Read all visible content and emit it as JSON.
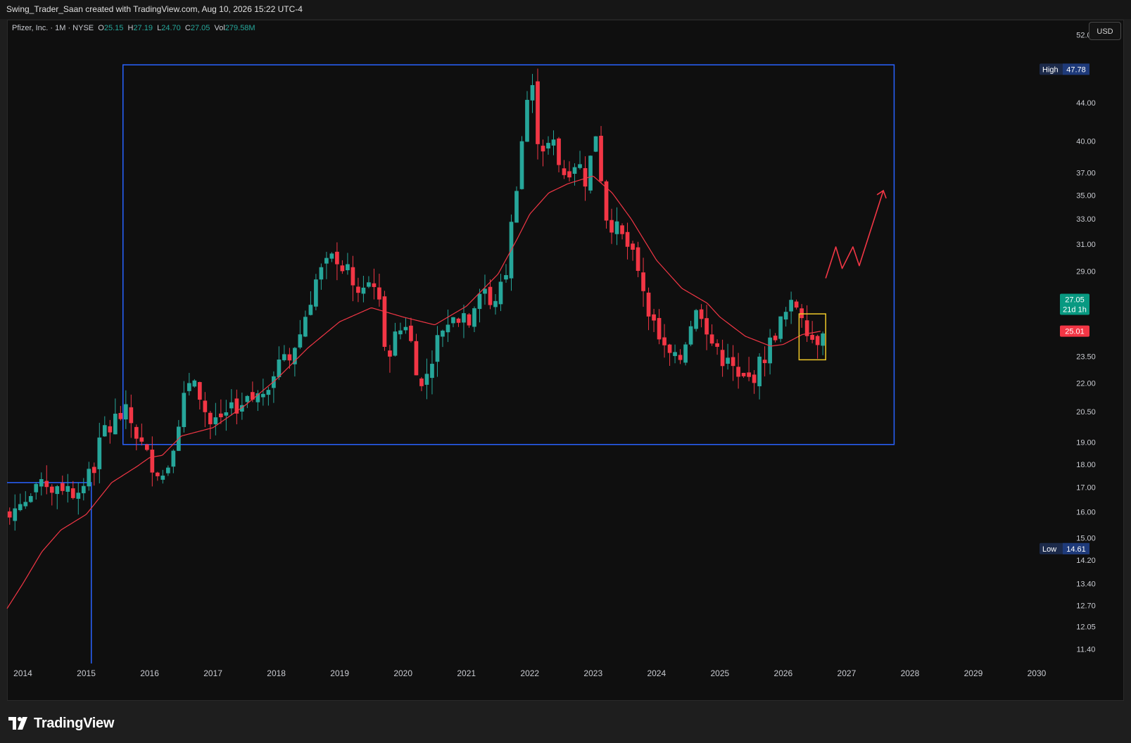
{
  "header": {
    "attribution": "Swing_Trader_Saan created with TradingView.com, Aug 10, 2026 15:22 UTC-4"
  },
  "legend": {
    "symbol": "Pfizer, Inc. · 1M · NYSE",
    "o_label": "O",
    "o_value": "25.15",
    "h_label": "H",
    "h_value": "27.19",
    "l_label": "L",
    "l_value": "24.70",
    "c_label": "C",
    "c_value": "27.05",
    "vol_label": "Vol",
    "vol_value": "279.58M"
  },
  "currency_button": "USD",
  "brand": {
    "name": "TradingView"
  },
  "colors": {
    "background": "#0f0f0f",
    "up": "#26a69a",
    "down": "#f23645",
    "moving_average": "#f23645",
    "range_box": "#2962ff",
    "highlight_box": "#f0c929",
    "projection_arrow": "#f23645"
  },
  "chart_data": {
    "type": "candlestick",
    "symbol": "PFE",
    "interval": "1M",
    "scale": "log",
    "ylim": [
      11.0,
      54.0
    ],
    "xlim": [
      2013.75,
      2030.3
    ],
    "x_ticks": [
      "2014",
      "2015",
      "2016",
      "2017",
      "2018",
      "2019",
      "2020",
      "2021",
      "2022",
      "2023",
      "2024",
      "2025",
      "2026",
      "2027",
      "2028",
      "2029",
      "2030"
    ],
    "y_ticks": [
      "52.00",
      "44.00",
      "40.00",
      "37.00",
      "35.00",
      "33.00",
      "31.00",
      "29.00",
      "23.50",
      "22.00",
      "20.50",
      "19.00",
      "18.00",
      "17.00",
      "16.00",
      "15.00",
      "14.20",
      "13.40",
      "12.70",
      "12.05",
      "11.40"
    ],
    "price_labels": [
      {
        "tag": "High",
        "value": "47.78",
        "price": 47.78,
        "kind": "high"
      },
      {
        "tag": "Low",
        "value": "14.61",
        "price": 14.61,
        "kind": "low"
      },
      {
        "tag": "",
        "value": "27.05",
        "sub": "21d 1h",
        "price": 27.05,
        "kind": "last"
      },
      {
        "tag": "",
        "value": "25.01",
        "price": 25.01,
        "kind": "ma"
      }
    ],
    "ma_anchors": [
      {
        "x": 2013.75,
        "y": 12.6
      },
      {
        "x": 2014.0,
        "y": 13.4
      },
      {
        "x": 2014.3,
        "y": 14.5
      },
      {
        "x": 2014.6,
        "y": 15.3
      },
      {
        "x": 2015.0,
        "y": 15.9
      },
      {
        "x": 2015.4,
        "y": 17.2
      },
      {
        "x": 2015.8,
        "y": 17.9
      },
      {
        "x": 2016.0,
        "y": 18.3
      },
      {
        "x": 2016.2,
        "y": 18.4
      },
      {
        "x": 2016.5,
        "y": 19.3
      },
      {
        "x": 2017.0,
        "y": 19.7
      },
      {
        "x": 2017.5,
        "y": 20.8
      },
      {
        "x": 2018.0,
        "y": 22.2
      },
      {
        "x": 2018.5,
        "y": 24.0
      },
      {
        "x": 2019.0,
        "y": 25.6
      },
      {
        "x": 2019.5,
        "y": 26.5
      },
      {
        "x": 2020.0,
        "y": 25.9
      },
      {
        "x": 2020.5,
        "y": 25.4
      },
      {
        "x": 2021.0,
        "y": 26.6
      },
      {
        "x": 2021.5,
        "y": 28.8
      },
      {
        "x": 2021.8,
        "y": 31.4
      },
      {
        "x": 2022.0,
        "y": 33.4
      },
      {
        "x": 2022.3,
        "y": 35.2
      },
      {
        "x": 2022.6,
        "y": 36.0
      },
      {
        "x": 2023.0,
        "y": 36.7
      },
      {
        "x": 2023.3,
        "y": 35.2
      },
      {
        "x": 2023.6,
        "y": 33.0
      },
      {
        "x": 2024.0,
        "y": 29.8
      },
      {
        "x": 2024.4,
        "y": 27.8
      },
      {
        "x": 2024.8,
        "y": 26.8
      },
      {
        "x": 2025.0,
        "y": 25.9
      },
      {
        "x": 2025.4,
        "y": 24.7
      },
      {
        "x": 2025.8,
        "y": 24.1
      },
      {
        "x": 2026.0,
        "y": 24.2
      },
      {
        "x": 2026.3,
        "y": 24.8
      },
      {
        "x": 2026.6,
        "y": 25.01
      }
    ],
    "range_box": {
      "x1": 2015.58,
      "x2": 2027.75,
      "y_top": 48.3,
      "y_bottom": 18.9
    },
    "base_box": {
      "x1": 2013.75,
      "x2": 2015.08,
      "y_top": 17.2,
      "y_bottom": 11.0
    },
    "highlight_box": {
      "x1": 2026.25,
      "x2": 2026.67,
      "y_top": 26.1,
      "y_bottom": 23.3
    },
    "projection_path": [
      {
        "x": 2026.67,
        "y": 28.5
      },
      {
        "x": 2026.83,
        "y": 30.8
      },
      {
        "x": 2026.93,
        "y": 29.2
      },
      {
        "x": 2027.1,
        "y": 30.8
      },
      {
        "x": 2027.2,
        "y": 29.4
      },
      {
        "x": 2027.58,
        "y": 35.4
      }
    ]
  }
}
